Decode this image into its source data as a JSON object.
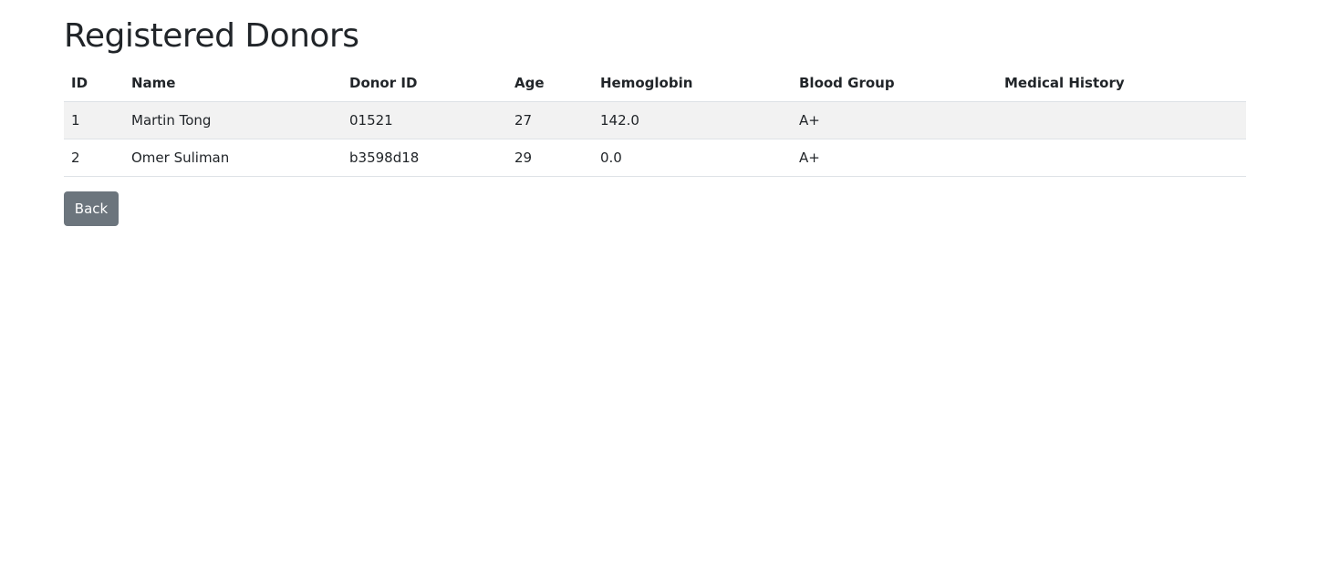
{
  "page_title": "Registered Donors",
  "table": {
    "headers": [
      "ID",
      "Name",
      "Donor ID",
      "Age",
      "Hemoglobin",
      "Blood Group",
      "Medical History"
    ],
    "rows": [
      [
        "1",
        "Martin Tong",
        "01521",
        "27",
        "142.0",
        "A+",
        ""
      ],
      [
        "2",
        "Omer Suliman",
        "b3598d18",
        "29",
        "0.0",
        "A+",
        ""
      ]
    ]
  },
  "back_label": "Back"
}
